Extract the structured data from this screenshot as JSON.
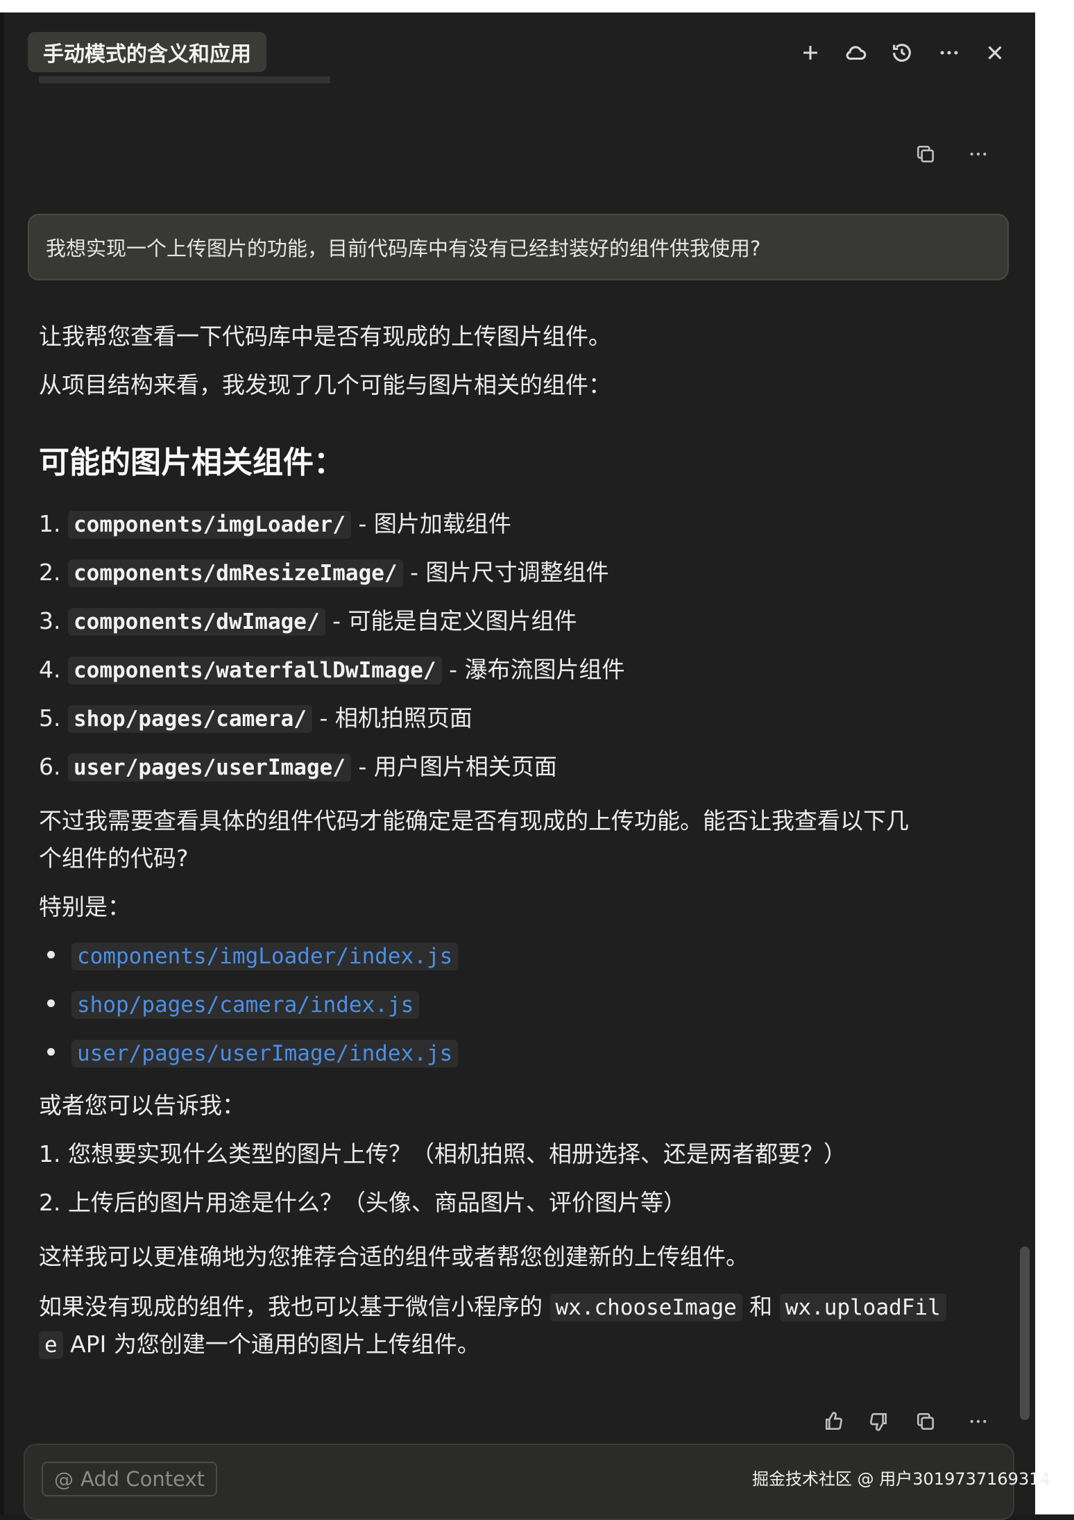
{
  "header": {
    "title": "手动模式的含义和应用",
    "icons": [
      "plus-icon",
      "cloud-icon",
      "history-icon",
      "more-icon",
      "close-icon"
    ]
  },
  "user_message": "我想实现一个上传图片的功能，目前代码库中有没有已经封装好的组件供我使用?",
  "assistant": {
    "intro1": "让我帮您查看一下代码库中是否有现成的上传图片组件。",
    "intro2": "从项目结构来看，我发现了几个可能与图片相关的组件：",
    "heading": "可能的图片相关组件：",
    "components": [
      {
        "num": "1.",
        "path": "components/imgLoader/",
        "desc": "- 图片加载组件"
      },
      {
        "num": "2.",
        "path": "components/dmResizeImage/",
        "desc": "- 图片尺寸调整组件"
      },
      {
        "num": "3.",
        "path": "components/dwImage/",
        "desc": "- 可能是自定义图片组件"
      },
      {
        "num": "4.",
        "path": "components/waterfallDwImage/",
        "desc": "- 瀑布流图片组件"
      },
      {
        "num": "5.",
        "path": "shop/pages/camera/",
        "desc": "- 相机拍照页面"
      },
      {
        "num": "6.",
        "path": "user/pages/userImage/",
        "desc": "- 用户图片相关页面"
      }
    ],
    "need_line1": "不过我需要查看具体的组件代码才能确定是否有现成的上传功能。能否让我查看以下几",
    "need_line2": "个组件的代码?",
    "especially": "特别是：",
    "files": [
      "components/imgLoader/index.js",
      "shop/pages/camera/index.js",
      "user/pages/userImage/index.js"
    ],
    "or_tell": "或者您可以告诉我：",
    "questions": [
      {
        "num": "1.",
        "text": "您想要实现什么类型的图片上传？（相机拍照、相册选择、还是两者都要？）"
      },
      {
        "num": "2.",
        "text": "上传后的图片用途是什么？（头像、商品图片、评价图片等）"
      }
    ],
    "so_line": "这样我可以更准确地为您推荐合适的组件或者帮您创建新的上传组件。",
    "final_pre": "如果没有现成的组件，我也可以基于微信小程序的",
    "final_code1": "wx.chooseImage",
    "final_and": "和",
    "final_code2a": "wx.uploadFil",
    "final_code2b": "e",
    "final_post": "API 为您创建一个通用的图片上传组件。"
  },
  "input": {
    "add_context": "Add Context",
    "at_symbol": "@"
  },
  "watermark": "掘金技术社区 @ 用户3019737169314"
}
